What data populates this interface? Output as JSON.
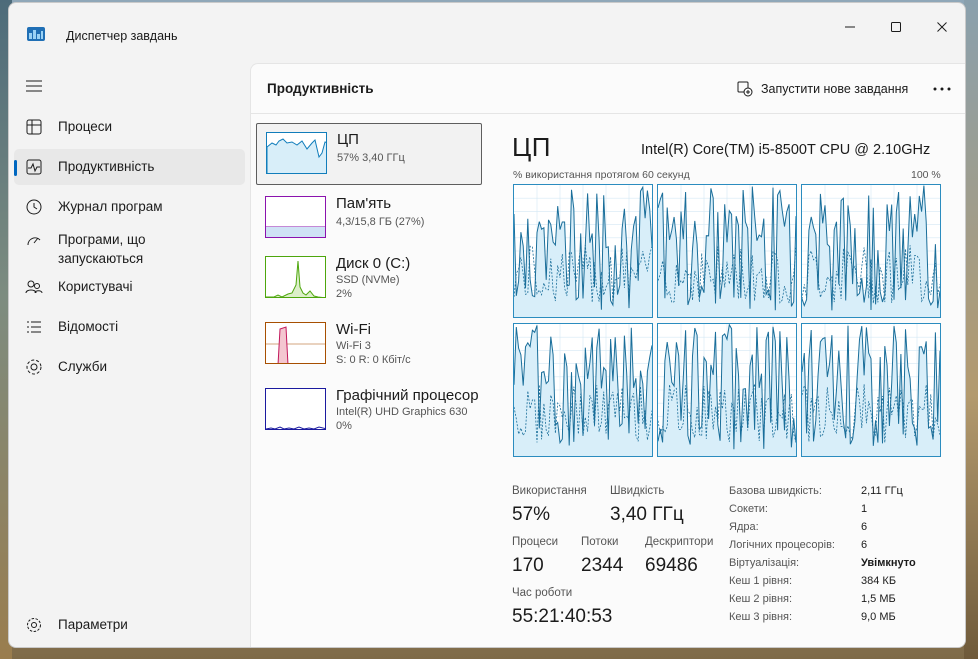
{
  "window": {
    "title": "Диспетчер завдань"
  },
  "nav": {
    "items": [
      {
        "label": "Процеси",
        "icon": "processes-icon"
      },
      {
        "label": "Продуктивність",
        "icon": "performance-icon",
        "active": true
      },
      {
        "label": "Журнал програм",
        "icon": "app-history-icon"
      },
      {
        "label": "Програми, що запускаються",
        "icon": "startup-apps-icon"
      },
      {
        "label": "Користувачі",
        "icon": "users-icon"
      },
      {
        "label": "Відомості",
        "icon": "details-icon"
      },
      {
        "label": "Служби",
        "icon": "services-icon"
      }
    ],
    "settings_label": "Параметри"
  },
  "header": {
    "title": "Продуктивність",
    "new_task_label": "Запустити нове завдання"
  },
  "resources": [
    {
      "name": "ЦП",
      "line1": "57%  3,40 ГГц",
      "line2": "",
      "color": "#117dbb"
    },
    {
      "name": "Пам'ять",
      "line1": "4,3/15,8 ГБ (27%)",
      "line2": "",
      "color": "#8b12ae"
    },
    {
      "name": "Диск 0 (C:)",
      "line1": "SSD (NVMe)",
      "line2": "2%",
      "color": "#4da60c"
    },
    {
      "name": "Wi-Fi",
      "line1": "Wi-Fi 3",
      "line2": "S: 0  R: 0 Кбіт/с",
      "color": "#a74f01"
    },
    {
      "name": "Графічний процесор",
      "line1": "Intel(R) UHD Graphics 630",
      "line2": "0%",
      "color": "#1b1a9f"
    }
  ],
  "cpu": {
    "title": "ЦП",
    "model": "Intel(R) Core(TM) i5-8500T CPU @ 2.10GHz",
    "axis_left": "% використання протягом 60 секунд",
    "axis_right": "100 %",
    "core_count": 6,
    "stats": {
      "utilization_label": "Використання",
      "utilization_value": "57%",
      "speed_label": "Швидкість",
      "speed_value": "3,40 ГГц",
      "processes_label": "Процеси",
      "processes_value": "170",
      "threads_label": "Потоки",
      "threads_value": "2344",
      "handles_label": "Дескриптори",
      "handles_value": "69486",
      "uptime_label": "Час роботи",
      "uptime_value": "55:21:40:53"
    },
    "details": [
      {
        "key": "Базова швидкість:",
        "value": "2,11 ГГц"
      },
      {
        "key": "Сокети:",
        "value": "1"
      },
      {
        "key": "Ядра:",
        "value": "6"
      },
      {
        "key": "Логічних процесорів:",
        "value": "6"
      },
      {
        "key": "Віртуалізація:",
        "value": "Увімкнуто",
        "bold": true
      },
      {
        "key": "Кеш 1 рівня:",
        "value": "384 КБ"
      },
      {
        "key": "Кеш 2 рівня:",
        "value": "1,5 МБ"
      },
      {
        "key": "Кеш 3 рівня:",
        "value": "9,0 МБ"
      }
    ]
  },
  "colors": {
    "cpu_line": "#1a6e9a",
    "cpu_fill": "#d8eef9",
    "accent": "#0067c0"
  }
}
